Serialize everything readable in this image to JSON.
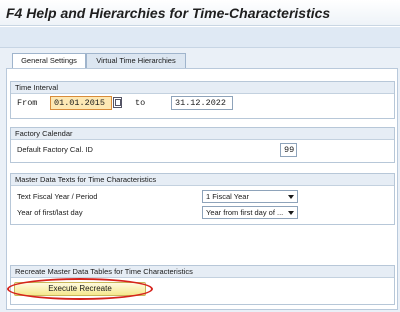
{
  "window": {
    "title": "F4 Help and Hierarchies for Time-Characteristics"
  },
  "tabs": [
    {
      "label": "General Settings",
      "active": true
    },
    {
      "label": "Virtual Time Hierarchies",
      "active": false
    }
  ],
  "time_interval": {
    "header": "Time Interval",
    "from_label": "From",
    "from_value": "01.01.2015",
    "to_label": "to",
    "to_value": "31.12.2022"
  },
  "factory_calendar": {
    "header": "Factory Calendar",
    "label": "Default Factory Cal. ID",
    "value": "99"
  },
  "master_data_texts": {
    "header": "Master Data Texts for Time Characteristics",
    "fiscal_label": "Text Fiscal Year / Period",
    "fiscal_value": "1 Fiscal Year",
    "year_label": "Year of first/last day",
    "year_value": "Year from first day of ..."
  },
  "recreate": {
    "header": "Recreate Master Data Tables for Time Characteristics",
    "button_label": "Execute Recreate"
  },
  "colors": {
    "focus_field": "#fde8b4",
    "button_fill": "#f5e88e",
    "highlight_ring": "#d6231c"
  }
}
